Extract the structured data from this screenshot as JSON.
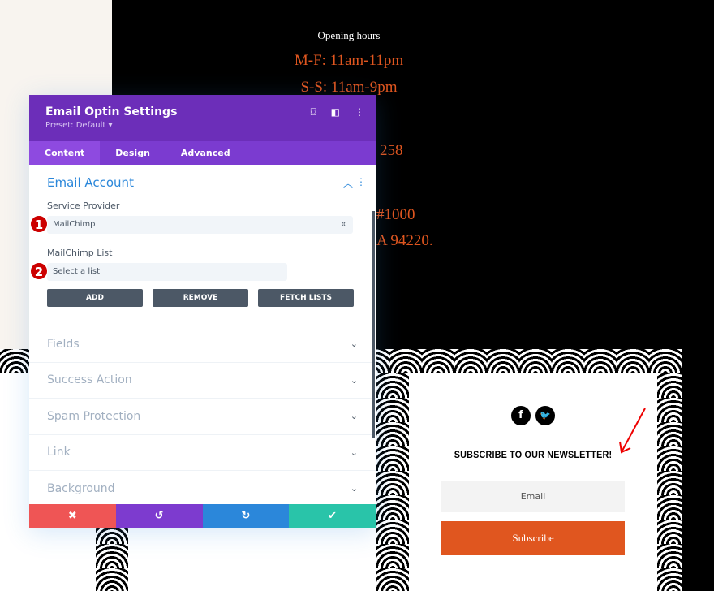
{
  "background": {
    "opening_title": "Opening hours",
    "lines": [
      "M-F: 11am-11pm",
      "S-S: 11am-9pm",
      "258",
      "#1000",
      "A 94220."
    ]
  },
  "panel": {
    "title": "Email Optin Settings",
    "preset": "Preset: Default ▾",
    "icons": [
      "focus-icon",
      "split-view-icon",
      "more-vertical-icon"
    ],
    "tabs": [
      {
        "label": "Content",
        "active": true
      },
      {
        "label": "Design"
      },
      {
        "label": "Advanced"
      }
    ],
    "email_account": {
      "title": "Email Account",
      "service_provider_label": "Service Provider",
      "service_provider_value": "MailChimp",
      "list_label": "MailChimp List",
      "list_placeholder": "Select a list",
      "buttons": {
        "add": "ADD",
        "remove": "REMOVE",
        "fetch": "FETCH LISTS"
      }
    },
    "sections": [
      "Fields",
      "Success Action",
      "Spam Protection",
      "Link",
      "Background"
    ],
    "footer": {
      "cancel": "✖",
      "undo": "↺",
      "redo": "↻",
      "save": "✔"
    },
    "colors": {
      "header": "#6c2eb9",
      "accent": "#2b87da",
      "cancel": "#ef5555",
      "undo": "#7d3bcf",
      "redo": "#2b87da",
      "save": "#29c4a9"
    }
  },
  "markers": [
    "1",
    "2"
  ],
  "newsletter": {
    "heading": "SUBSCRIBE TO OUR NEWSLETTER!",
    "email_placeholder": "Email",
    "subscribe": "Subscribe",
    "social": [
      "facebook-icon",
      "twitter-icon"
    ],
    "button_color": "#e0561f"
  }
}
